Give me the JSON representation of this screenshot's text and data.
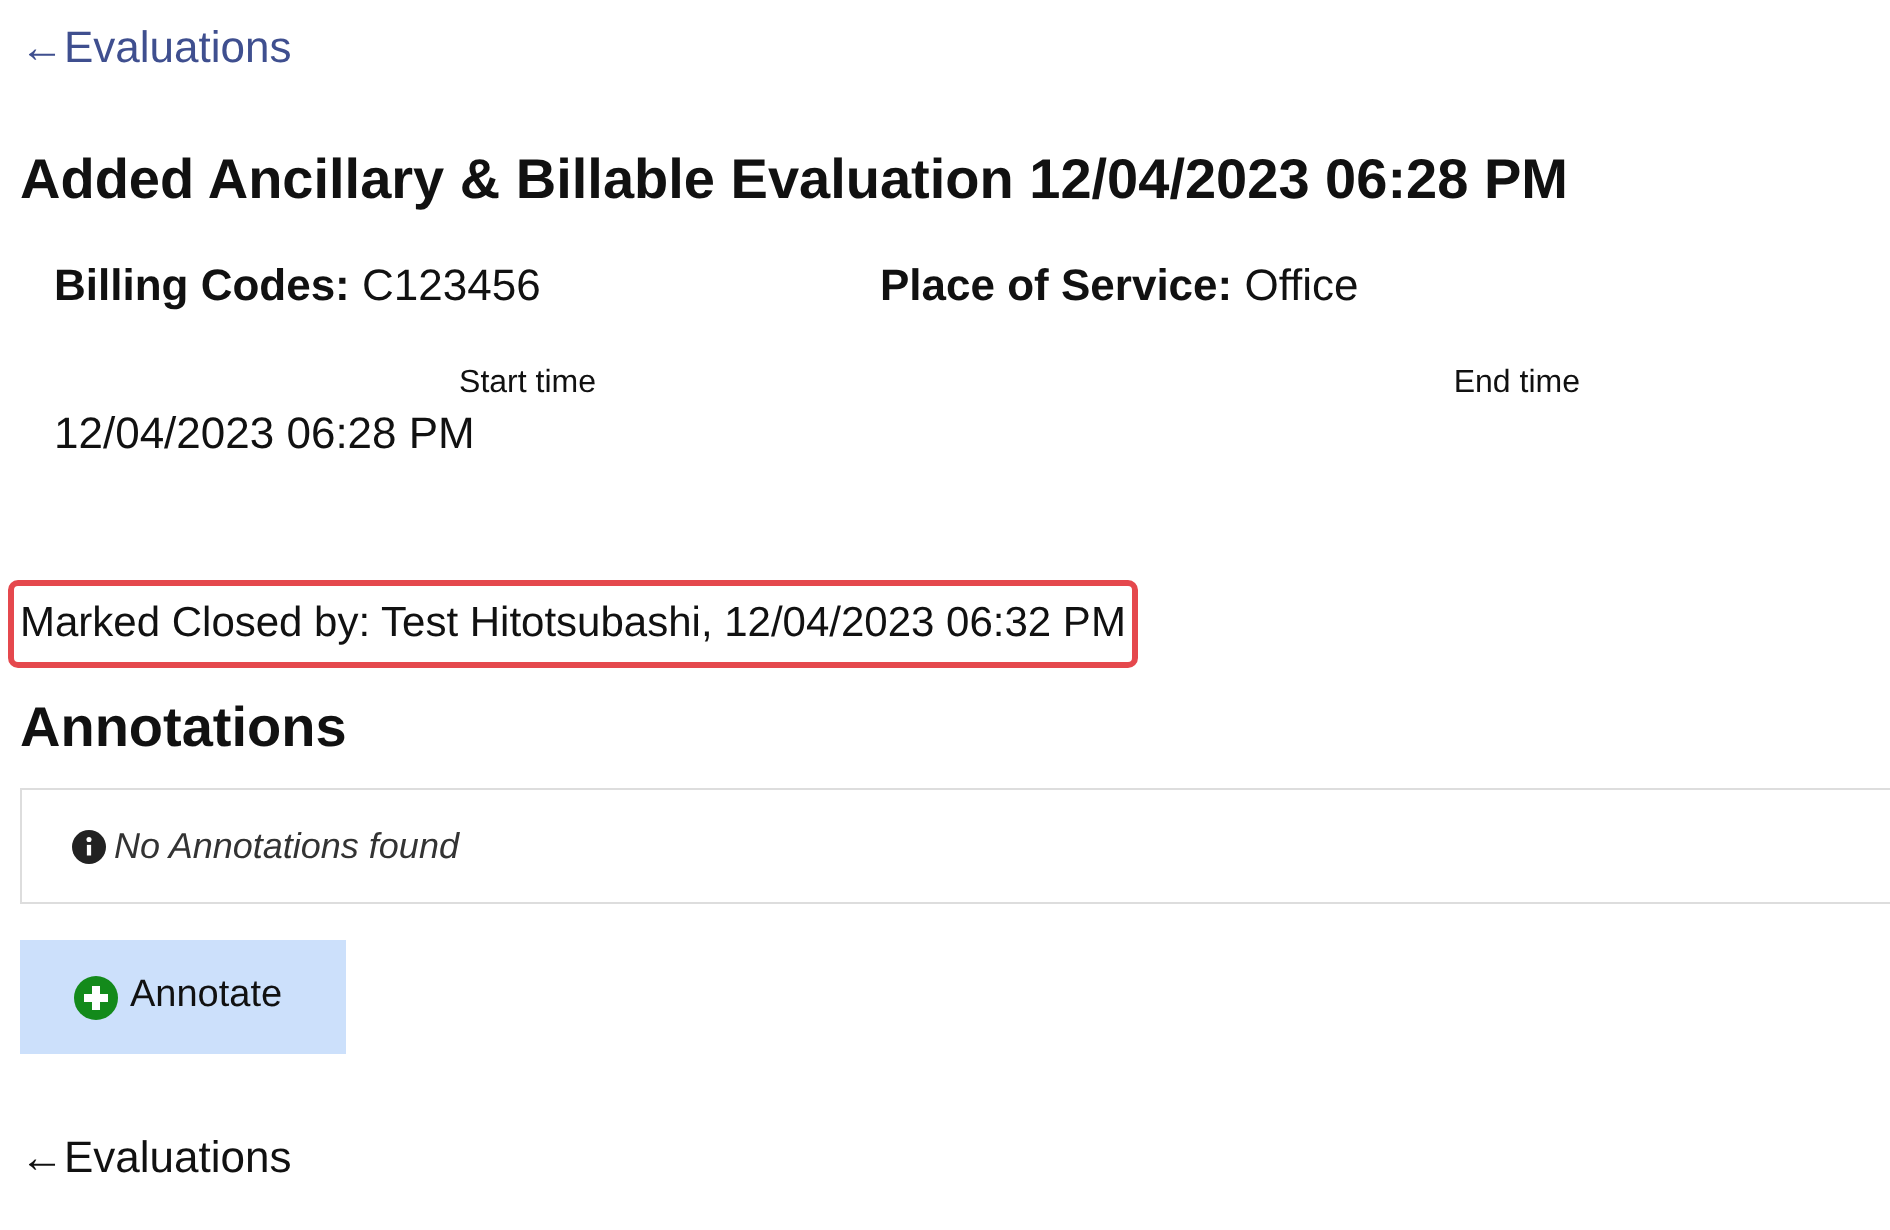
{
  "back_link": "←Evaluations",
  "title": "Added Ancillary & Billable Evaluation 12/04/2023 06:28 PM",
  "fields": [
    {
      "label": "Billing Codes:",
      "value": "C123456"
    },
    {
      "label": "Place of Service:",
      "value": "Office"
    }
  ],
  "times": [
    {
      "label": "Start time",
      "value": "12/04/2023 06:28 PM"
    },
    {
      "label": "End time"
    }
  ],
  "closed_note": "Marked Closed by: Test Hitotsubashi, 12/04/2023 06:32 PM",
  "annotations": {
    "heading": "Annotations",
    "empty_message": "No Annotations found",
    "button": "Annotate"
  },
  "footer_link": "←Evaluations"
}
